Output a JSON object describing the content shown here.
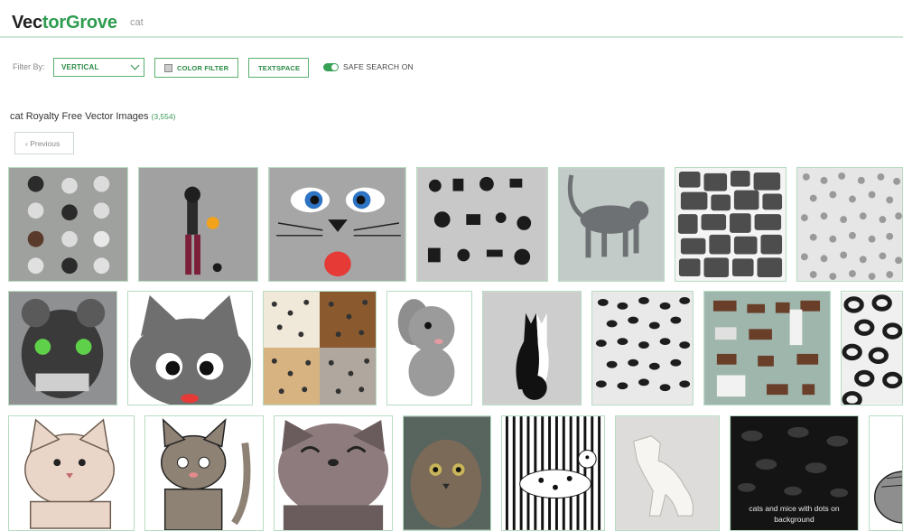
{
  "header": {
    "logo_part1": "Vec",
    "logo_part2": "t",
    "logo_part3": "orGrove",
    "search_value": "cat",
    "accent_color": "#2e9c4f"
  },
  "filters": {
    "filter_by_label": "Filter By:",
    "orientation_value": "VERTICAL",
    "color_filter_label": "COLOR FILTER",
    "text_space_label": "TEXTSPACE",
    "safe_search_label": "SAFE SEARCH ON",
    "safe_search_on": true
  },
  "results": {
    "title": "cat Royalty Free Vector Images",
    "count": "(3,554)",
    "previous_label": "‹ Previous"
  },
  "tiles": [
    {
      "row": 1,
      "subject": "cat faces icon set"
    },
    {
      "row": 1,
      "subject": "girl with pumpkin and black cat"
    },
    {
      "row": 1,
      "subject": "cartoon cat face with blue eyes"
    },
    {
      "row": 1,
      "subject": "black icon collage"
    },
    {
      "row": 1,
      "subject": "walking grey big cat"
    },
    {
      "row": 1,
      "subject": "giraffe skin pattern"
    },
    {
      "row": 1,
      "subject": "leopard dots pattern"
    },
    {
      "row": 2,
      "subject": "robot mask"
    },
    {
      "row": 2,
      "subject": "grey cartoon cat"
    },
    {
      "row": 2,
      "subject": "animal print patterns"
    },
    {
      "row": 2,
      "subject": "grey elephant"
    },
    {
      "row": 2,
      "subject": "two cats silhouette"
    },
    {
      "row": 2,
      "subject": "leopard skin pattern"
    },
    {
      "row": 2,
      "subject": "farm animals set"
    },
    {
      "row": 2,
      "subject": "leopard print"
    },
    {
      "row": 3,
      "subject": "fluffy cat sketch"
    },
    {
      "row": 3,
      "subject": "cartoon sitting cat"
    },
    {
      "row": 3,
      "subject": "smiling grey cat"
    },
    {
      "row": 3,
      "subject": "fluffy cat photo"
    },
    {
      "row": 3,
      "subject": "dalmatian dog stripes"
    },
    {
      "row": 3,
      "subject": "paper cut cat"
    },
    {
      "row": 3,
      "subject": "cats and mice pattern",
      "caption": "cats and mice with dots on background"
    },
    {
      "row": 3,
      "subject": "cartoon cat partial"
    }
  ]
}
